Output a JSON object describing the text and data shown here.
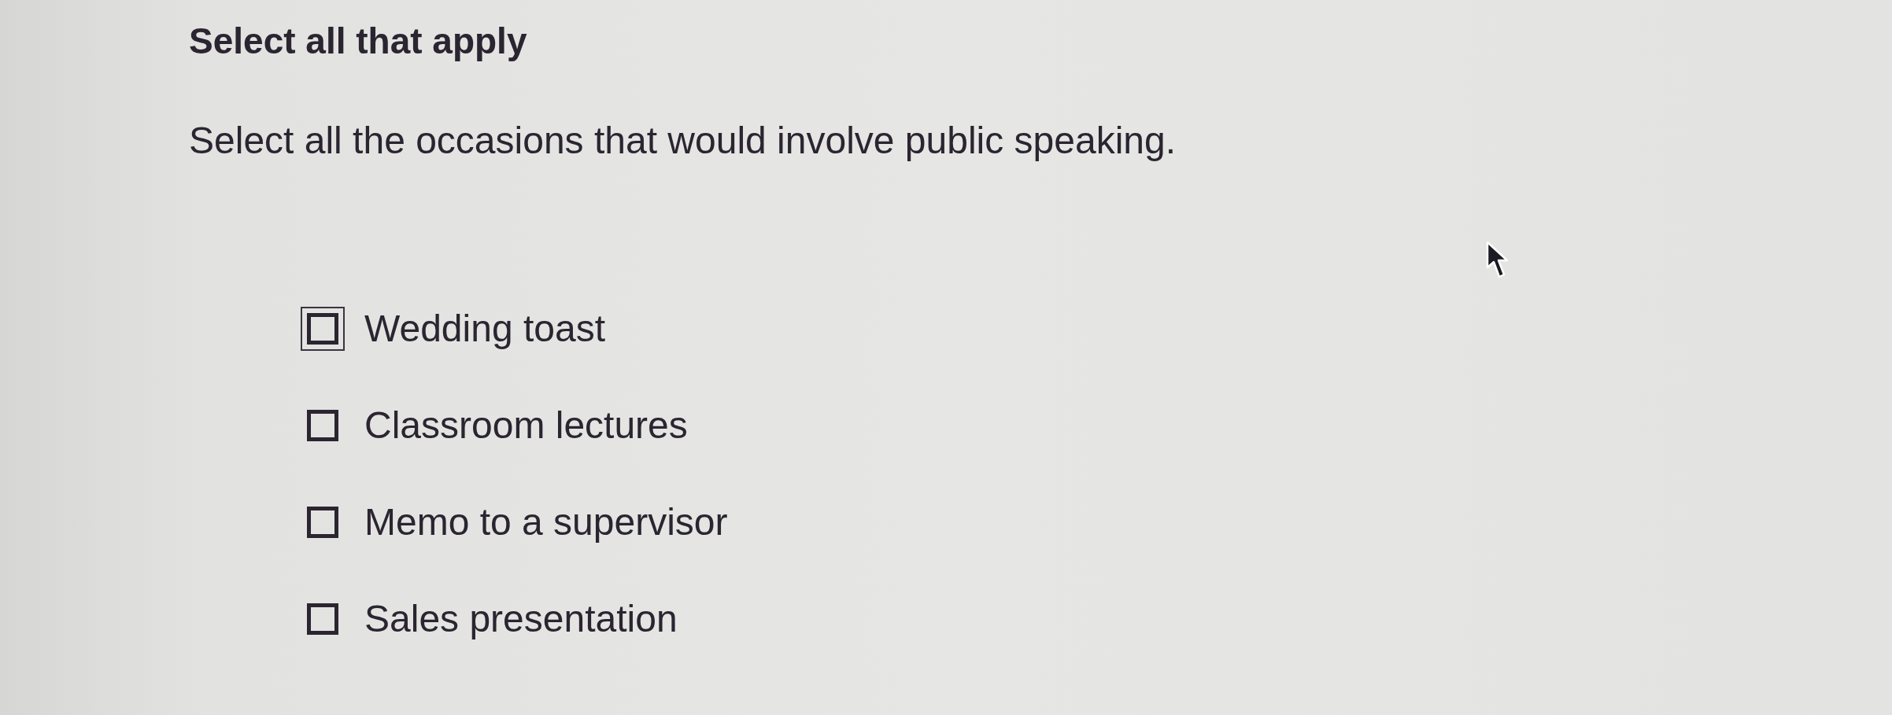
{
  "heading": "Select all that apply",
  "question": "Select all the occasions that would involve public speaking.",
  "options": [
    {
      "label": "Wedding toast",
      "checked": false,
      "focused": true
    },
    {
      "label": "Classroom lectures",
      "checked": false,
      "focused": false
    },
    {
      "label": "Memo to a supervisor",
      "checked": false,
      "focused": false
    },
    {
      "label": "Sales presentation",
      "checked": false,
      "focused": false
    }
  ]
}
